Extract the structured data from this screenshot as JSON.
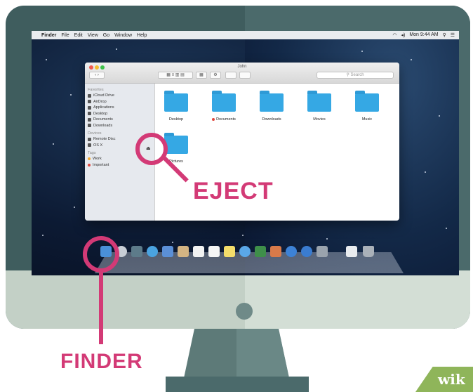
{
  "menubar": {
    "items": [
      "Finder",
      "File",
      "Edit",
      "View",
      "Go",
      "Window",
      "Help"
    ],
    "clock": "Mon 9:44 AM"
  },
  "finder": {
    "window_title": "John",
    "search_placeholder": "Search",
    "sidebar": {
      "favorites_header": "Favorites",
      "favorites": [
        "iCloud Drive",
        "AirDrop",
        "Applications",
        "Desktop",
        "Documents",
        "Downloads"
      ],
      "devices_header": "Devices",
      "devices": [
        "Remote Disc",
        "OS X"
      ],
      "tags_header": "Tags",
      "tags": [
        {
          "label": "Work",
          "color": "#f0a830"
        },
        {
          "label": "Important",
          "color": "#e0483f"
        }
      ]
    },
    "folders": [
      "Desktop",
      "Documents",
      "Downloads",
      "Movies",
      "Music",
      "Pictures"
    ],
    "folder_color": "#35a8e4"
  },
  "callouts": {
    "eject": "EJECT",
    "finder": "FINDER",
    "color": "#d33a76"
  },
  "watermark": "wik"
}
